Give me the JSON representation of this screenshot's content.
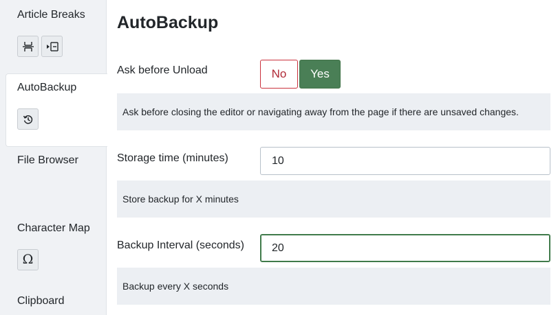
{
  "sidebar": {
    "article_breaks": {
      "title": "Article Breaks",
      "icons": [
        "page-break-icon",
        "read-more-icon"
      ]
    },
    "autobackup": {
      "title": "AutoBackup",
      "icons": [
        "restore-icon"
      ]
    },
    "file_browser": {
      "title": "File Browser"
    },
    "character_map": {
      "title": "Character Map",
      "icons": [
        "omega-icon"
      ],
      "omega_glyph": "Ω"
    },
    "clipboard": {
      "title": "Clipboard"
    }
  },
  "main": {
    "title": "AutoBackup",
    "ask_before_unload": {
      "label": "Ask before Unload",
      "options": [
        "No",
        "Yes"
      ],
      "selected": "Yes",
      "description": "Ask before closing the editor or navigating away from the page if there are unsaved changes."
    },
    "storage_time": {
      "label": "Storage time (minutes)",
      "value": "10",
      "description": "Store backup for X minutes"
    },
    "backup_interval": {
      "label": "Backup Interval (seconds)",
      "value": "20",
      "description": "Backup every X seconds"
    }
  },
  "colors": {
    "accent_green": "#4a7f56",
    "no_red": "#b02a37",
    "sidebar_bg": "#f0f2f5",
    "description_bg": "#eceff3"
  }
}
